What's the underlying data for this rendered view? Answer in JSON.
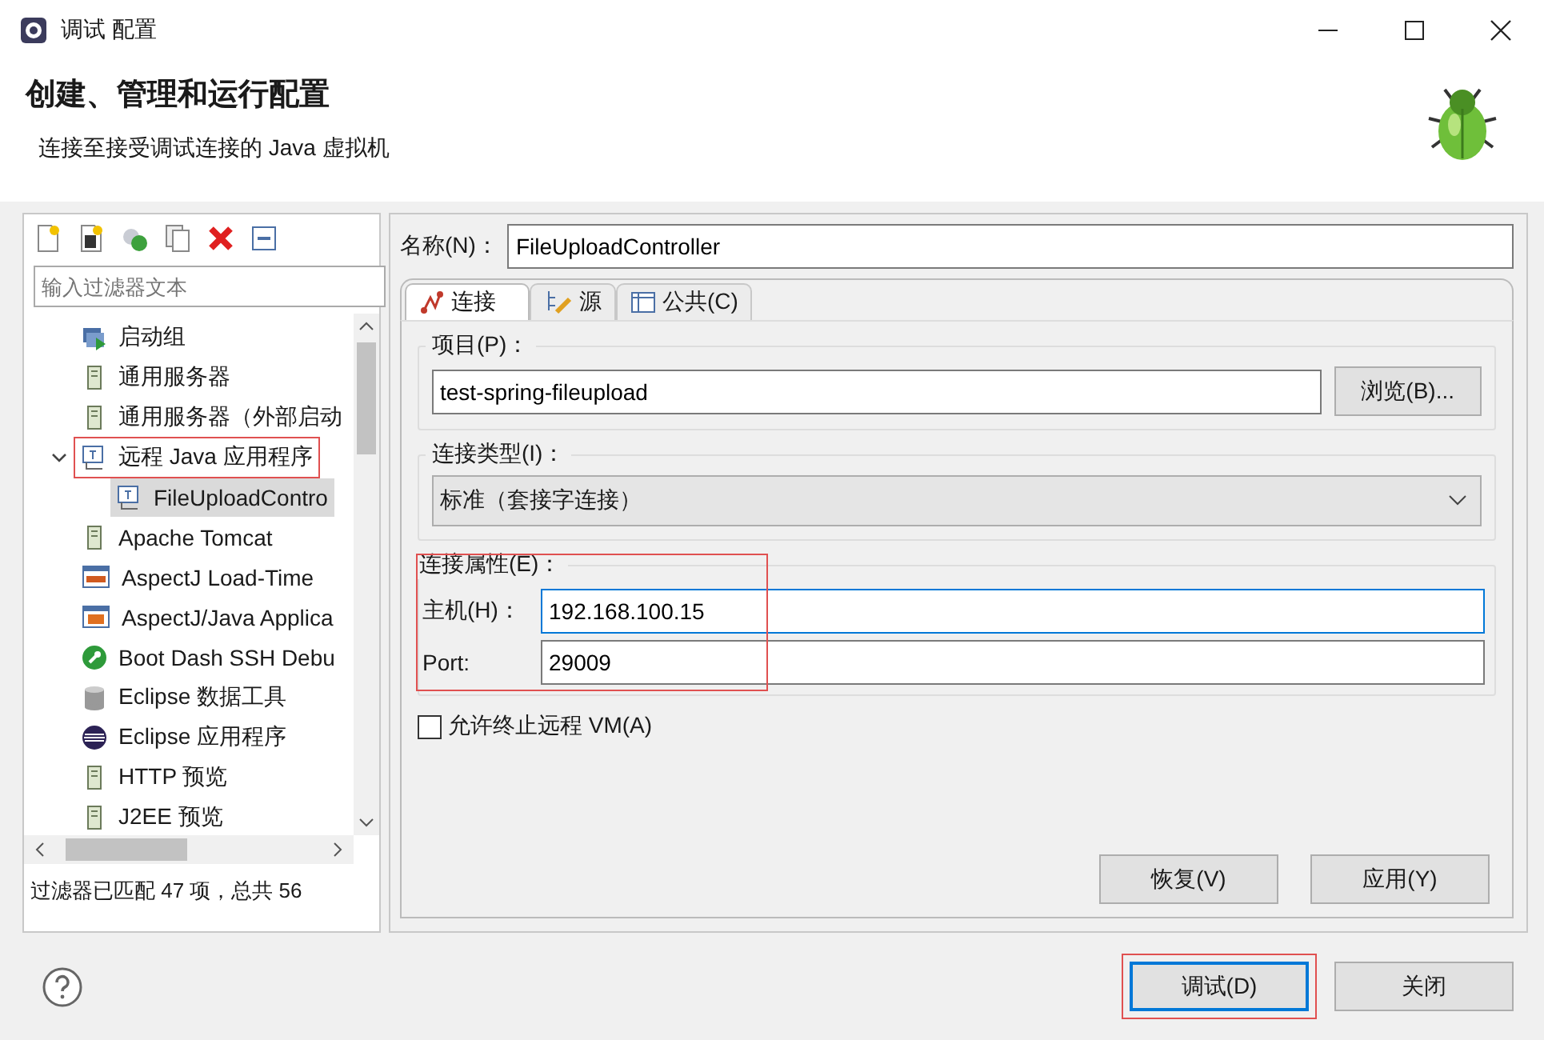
{
  "window": {
    "title": "调试 配置"
  },
  "header": {
    "title": "创建、管理和运行配置",
    "subtitle": "连接至接受调试连接的 Java 虚拟机"
  },
  "filter": {
    "placeholder": "输入过滤器文本"
  },
  "tree": [
    {
      "label": "启动组",
      "kind": "group",
      "selected": false
    },
    {
      "label": "通用服务器",
      "kind": "server",
      "selected": false
    },
    {
      "label": "通用服务器（外部启动",
      "kind": "server",
      "selected": false
    },
    {
      "label": "远程 Java 应用程序",
      "kind": "remote",
      "selected": false,
      "expanded": true,
      "highlighted": true,
      "children": [
        {
          "label": "FileUploadContro",
          "kind": "remote",
          "selected": true
        }
      ]
    },
    {
      "label": "Apache Tomcat",
      "kind": "server",
      "selected": false
    },
    {
      "label": "AspectJ Load-Time",
      "kind": "ltw",
      "selected": false
    },
    {
      "label": "AspectJ/Java Applica",
      "kind": "aj",
      "selected": false
    },
    {
      "label": "Boot Dash SSH Debu",
      "kind": "boot",
      "selected": false
    },
    {
      "label": "Eclipse 数据工具",
      "kind": "db",
      "selected": false
    },
    {
      "label": "Eclipse 应用程序",
      "kind": "eclipse",
      "selected": false
    },
    {
      "label": "HTTP 预览",
      "kind": "server",
      "selected": false
    },
    {
      "label": "J2EE 预览",
      "kind": "server",
      "selected": false
    }
  ],
  "filter_status": "过滤器已匹配 47 项，总共 56",
  "name": {
    "label": "名称(N)：",
    "value": "FileUploadController"
  },
  "tabs": [
    {
      "label": "连接",
      "kind": "connect",
      "selected": true
    },
    {
      "label": "源",
      "kind": "source",
      "selected": false
    },
    {
      "label": "公共(C)",
      "kind": "table",
      "selected": false
    }
  ],
  "project": {
    "label": "项目(P)：",
    "value": "test-spring-fileupload",
    "button": "浏览(B)..."
  },
  "connection_type": {
    "label": "连接类型(I)：",
    "value": "标准（套接字连接）"
  },
  "connection_properties": {
    "label": "连接属性(E)：",
    "highlighted": true,
    "fields": [
      {
        "label": "主机(H)：",
        "value": "192.168.100.15",
        "focused": true
      },
      {
        "label": "Port:",
        "value": "29009",
        "focused": false
      }
    ]
  },
  "allow_terminate": {
    "label": "允许终止远程 VM(A)",
    "checked": false
  },
  "panel_buttons": [
    "恢复(V)",
    "应用(Y)"
  ],
  "dialog_buttons": [
    {
      "label": "调试(D)",
      "highlighted": true
    },
    {
      "label": "关闭",
      "highlighted": false
    }
  ]
}
